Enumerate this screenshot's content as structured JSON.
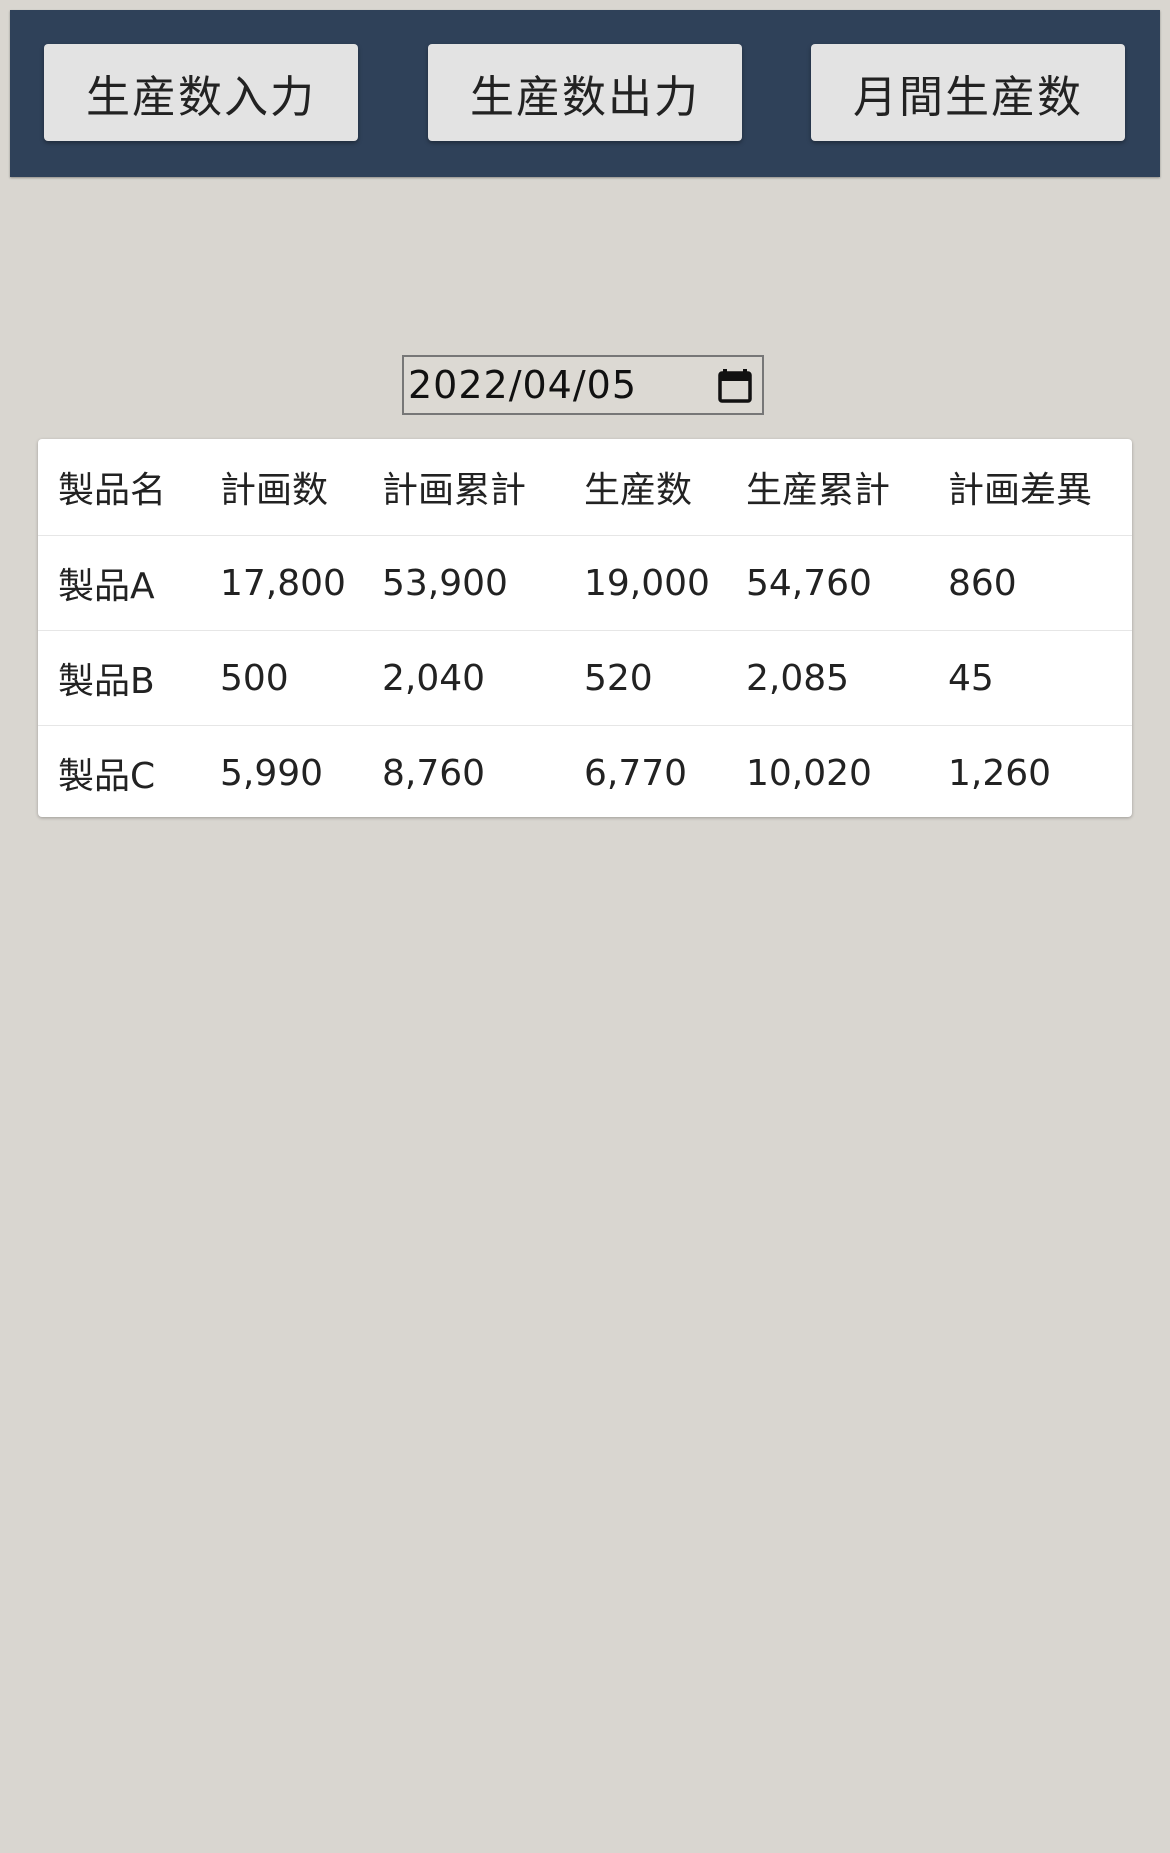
{
  "nav": {
    "buttons": [
      {
        "label": "生産数入力"
      },
      {
        "label": "生産数出力"
      },
      {
        "label": "月間生産数"
      }
    ]
  },
  "date_input": {
    "value": "2022/04/05",
    "icon": "calendar-icon"
  },
  "table": {
    "headers": [
      "製品名",
      "計画数",
      "計画累計",
      "生産数",
      "生産累計",
      "計画差異"
    ],
    "rows": [
      [
        "製品A",
        "17,800",
        "53,900",
        "19,000",
        "54,760",
        "860"
      ],
      [
        "製品B",
        "500",
        "2,040",
        "520",
        "2,085",
        "45"
      ],
      [
        "製品C",
        "5,990",
        "8,760",
        "6,770",
        "10,020",
        "1,260"
      ]
    ]
  },
  "colors": {
    "header_bg": "#2f4159",
    "page_bg": "#d9d6d0",
    "button_bg": "#e3e3e3",
    "card_bg": "#ffffff"
  }
}
